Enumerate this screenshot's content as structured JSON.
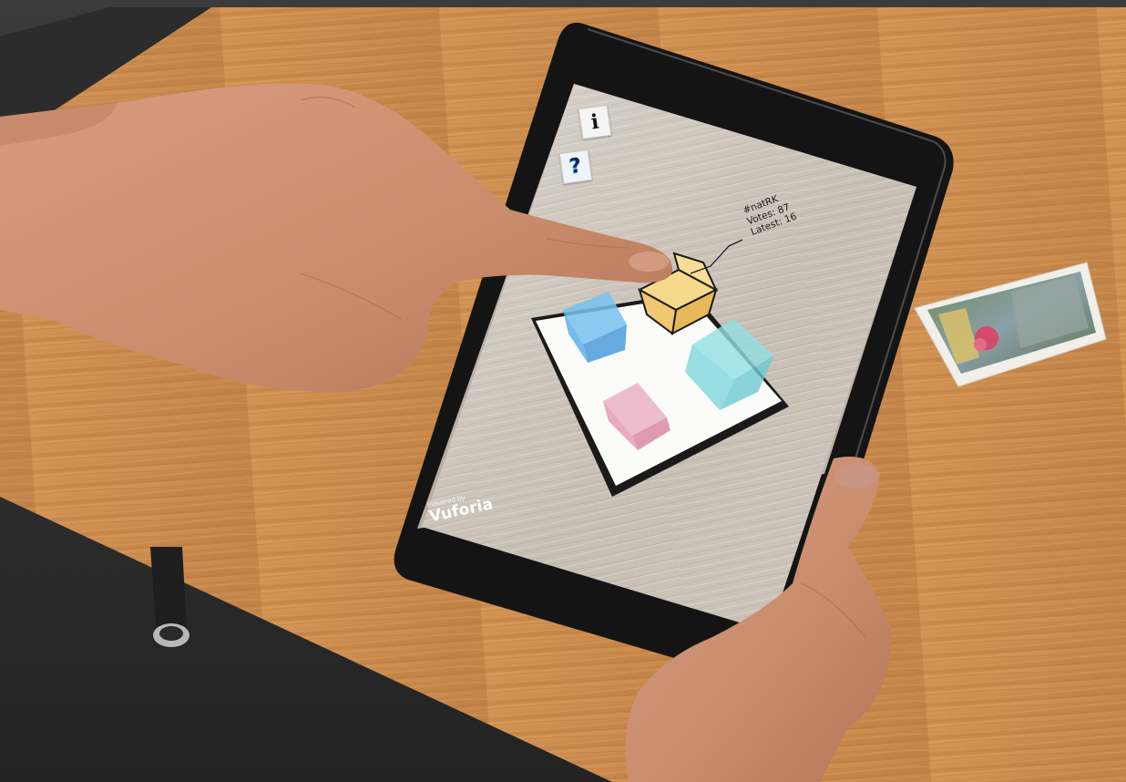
{
  "ar_view": {
    "info_label": "i",
    "help_label": "?",
    "callout": {
      "title": "#natRK",
      "votes": "Votes: 87",
      "latest": "Latest: 16"
    },
    "brand": {
      "powered_by": "Powered by",
      "name": "Vuforia"
    }
  },
  "colors": {
    "table_wood": "#c9884a",
    "tablet_bezel": "#151515",
    "screen_wood": "#c2b8ac",
    "marker_board": "#f8f8f6",
    "cube_blue": "#58aee9",
    "cube_cyan": "#7fd6dc",
    "cube_pink": "#e59db4",
    "cube_gold": "#f0c66e",
    "skin": "#c98b6c"
  },
  "icons": [
    "info-icon",
    "help-icon"
  ]
}
